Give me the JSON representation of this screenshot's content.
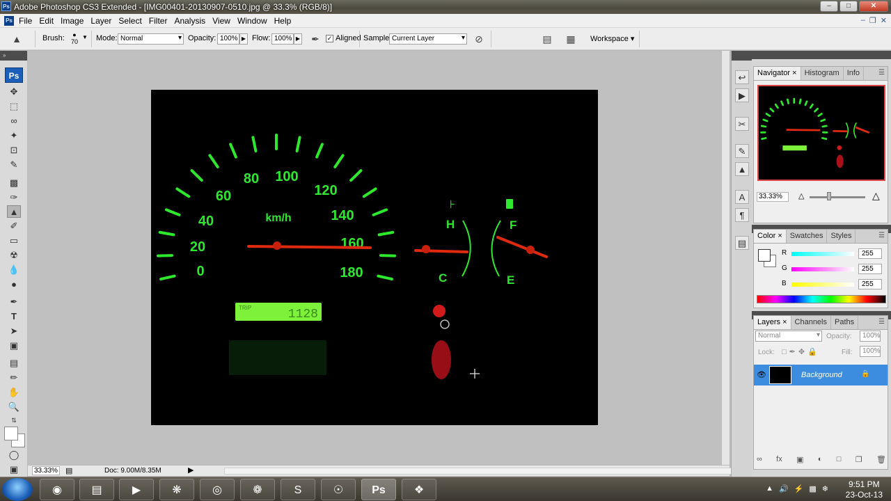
{
  "app": {
    "title": "Adobe Photoshop CS3 Extended - [IMG00401-20130907-0510.jpg @ 33.3% (RGB/8)]",
    "ps_short": "Ps",
    "window_buttons": [
      "–",
      "□",
      "✕"
    ]
  },
  "menu": {
    "items": [
      "File",
      "Edit",
      "Image",
      "Layer",
      "Select",
      "Filter",
      "Analysis",
      "View",
      "Window",
      "Help"
    ],
    "doc_buttons": [
      "–",
      "❐",
      "✕"
    ]
  },
  "options": {
    "brush_label": "Brush:",
    "brush_size": "70",
    "mode_label": "Mode:",
    "mode_value": "Normal",
    "opacity_label": "Opacity:",
    "opacity_value": "100%",
    "flow_label": "Flow:",
    "flow_value": "100%",
    "aligned_label": "Aligned",
    "aligned_checked": "✓",
    "sample_label": "Sample:",
    "sample_value": "Current Layer",
    "workspace_label": "Workspace ▾"
  },
  "tools": [
    "move-tool",
    "marquee-tool",
    "lasso-tool",
    "magic-wand-tool",
    "crop-tool",
    "slice-tool",
    "healing-brush-tool",
    "brush-tool",
    "clone-stamp-tool",
    "history-brush-tool",
    "eraser-tool",
    "paint-bucket-tool",
    "blur-tool",
    "dodge-tool",
    "pen-tool",
    "type-tool",
    "path-selection-tool",
    "rectangle-tool",
    "notes-tool",
    "eyedropper-tool",
    "hand-tool",
    "zoom-tool"
  ],
  "image_content": {
    "speed_labels": [
      "0",
      "20",
      "40",
      "60",
      "80",
      "100",
      "120",
      "140",
      "160",
      "180"
    ],
    "unit": "km/h",
    "odometer": "1128",
    "odo_prefix": "TRIP",
    "temp_high": "H",
    "temp_low": "C",
    "fuel_full": "F",
    "fuel_empty": "E"
  },
  "status": {
    "zoom": "33.33%",
    "doc": "Doc: 9.00M/8.35M"
  },
  "navigator": {
    "tabs": [
      "Navigator",
      "Histogram",
      "Info"
    ],
    "zoom": "33.33%"
  },
  "color": {
    "tabs": [
      "Color",
      "Swatches",
      "Styles"
    ],
    "channels": [
      {
        "label": "R",
        "value": "255"
      },
      {
        "label": "G",
        "value": "255"
      },
      {
        "label": "B",
        "value": "255"
      }
    ]
  },
  "layers": {
    "tabs": [
      "Layers",
      "Channels",
      "Paths"
    ],
    "blend": "Normal",
    "opacity_label": "Opacity:",
    "opacity_value": "100%",
    "lock_label": "Lock:",
    "fill_label": "Fill:",
    "fill_value": "100%",
    "layer_name": "Background"
  },
  "taskbar": {
    "apps": [
      "firefox",
      "explorer",
      "media-player",
      "app-purple",
      "chrome",
      "paint",
      "skype",
      "globe",
      "photoshop",
      "browser"
    ],
    "time": "9:51 PM",
    "date": "23-Oct-13"
  },
  "colors": {
    "gauge_green": "#2ee82e",
    "needle_red": "#e02a10",
    "selected_layer": "#3c8de0"
  }
}
